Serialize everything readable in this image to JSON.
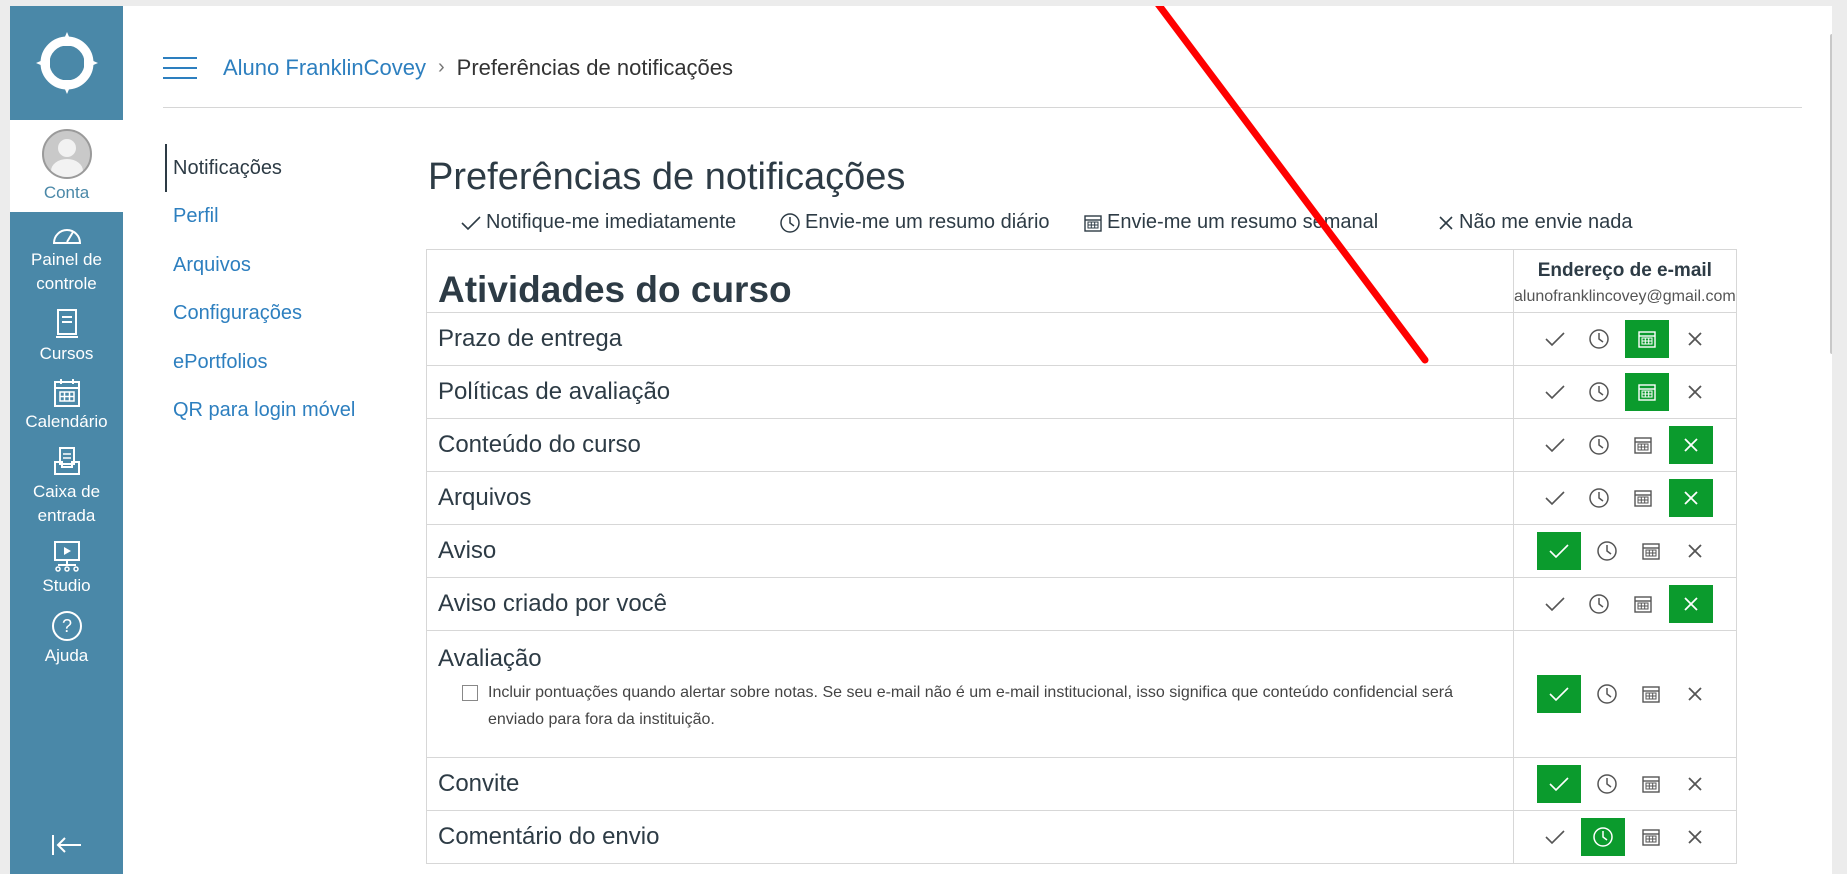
{
  "global_nav": {
    "account_label": "Conta",
    "items": [
      {
        "icon": "dashboard-icon",
        "label": "Painel de controle"
      },
      {
        "icon": "courses-icon",
        "label": "Cursos"
      },
      {
        "icon": "calendar-icon",
        "label": "Calendário"
      },
      {
        "icon": "inbox-icon",
        "label": "Caixa de entrada"
      },
      {
        "icon": "studio-icon",
        "label": "Studio"
      },
      {
        "icon": "help-icon",
        "label": "Ajuda"
      }
    ],
    "collapse_icon": "collapse-nav-icon",
    "brand_color": "#4a88a8"
  },
  "breadcrumb": {
    "user": "Aluno FranklinCovey",
    "separator": "›",
    "current": "Preferências de notificações"
  },
  "subnav": {
    "items": [
      {
        "label": "Notificações",
        "active": true
      },
      {
        "label": "Perfil",
        "active": false
      },
      {
        "label": "Arquivos",
        "active": false
      },
      {
        "label": "Configurações",
        "active": false
      },
      {
        "label": "ePortfolios",
        "active": false
      },
      {
        "label": "QR para login móvel",
        "active": false
      }
    ]
  },
  "page": {
    "title": "Preferências de notificações",
    "legend": {
      "immediately": "Notifique-me imediatamente",
      "daily": "Envie-me um resumo diário",
      "weekly": "Envie-me um resumo semanal",
      "never": "Não me envie nada"
    }
  },
  "table": {
    "category": "Atividades do curso",
    "channel_title": "Endereço de e-mail",
    "channel_address": "alunofranklincovey@gmail.com",
    "selected_color": "#0b9b2d",
    "rows": [
      {
        "name": "Prazo de entrega",
        "selected": "weekly"
      },
      {
        "name": "Políticas de avaliação",
        "selected": "weekly"
      },
      {
        "name": "Conteúdo do curso",
        "selected": "never"
      },
      {
        "name": "Arquivos",
        "selected": "never"
      },
      {
        "name": "Aviso",
        "selected": "immediately"
      },
      {
        "name": "Aviso criado por você",
        "selected": "never"
      },
      {
        "name": "Avaliação",
        "selected": "immediately",
        "checkbox_label": "Incluir pontuações quando alertar sobre notas. Se seu e-mail não é um e-mail institucional, isso significa que conteúdo confidencial será enviado para fora da instituição."
      },
      {
        "name": "Convite",
        "selected": "immediately"
      },
      {
        "name": "Comentário do envio",
        "selected": "daily"
      }
    ]
  }
}
